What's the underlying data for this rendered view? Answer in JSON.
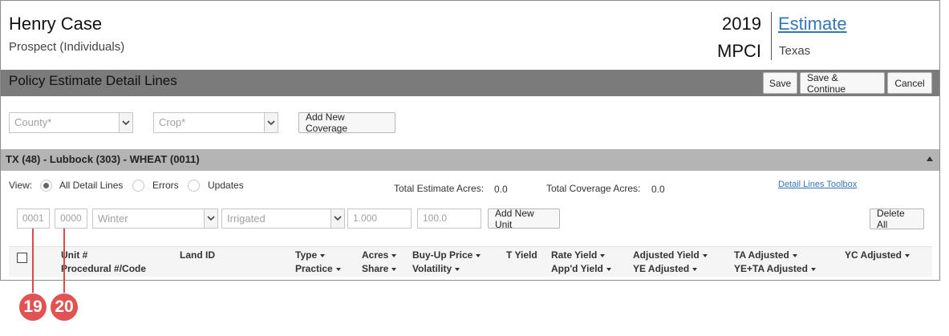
{
  "header": {
    "client_name": "Henry Case",
    "client_type": "Prospect (Individuals)",
    "year": "2019",
    "plan": "MPCI",
    "estimate_link": "Estimate",
    "state": "Texas"
  },
  "title_bar": {
    "title": "Policy Estimate Detail Lines",
    "save_label": "Save",
    "save_continue_label": "Save & Continue",
    "cancel_label": "Cancel"
  },
  "coverage_filters": {
    "county_placeholder": "County*",
    "crop_placeholder": "Crop*",
    "add_coverage_label": "Add New Coverage"
  },
  "coverage": {
    "title": "TX (48) - Lubbock (303) - WHEAT (0011)",
    "view_label": "View:",
    "view_options": [
      "All Detail Lines",
      "Errors",
      "Updates"
    ],
    "view_selected": "All Detail Lines",
    "total_estimate_acres_label": "Total Estimate Acres:",
    "total_estimate_acres_value": "0.0",
    "total_coverage_acres_label": "Total Coverage Acres:",
    "total_coverage_acres_value": "0.0",
    "toolbox_link": "Detail Lines Toolbox"
  },
  "unit_entry": {
    "unit_placeholder": "0001",
    "sub_placeholder": "0000",
    "type_selected": "Winter",
    "practice_selected": "Irrigated",
    "acres_placeholder": "1.000",
    "share_placeholder": "100.0",
    "add_unit_label": "Add New Unit",
    "delete_all_label": "Delete All"
  },
  "table_headers": {
    "unit": "Unit #",
    "procedural": "Procedural #/Code",
    "land_id": "Land ID",
    "type": "Type",
    "practice": "Practice",
    "acres": "Acres",
    "share": "Share",
    "buyup": "Buy-Up Price",
    "volatility": "Volatility",
    "t_yield": "T Yield",
    "rate_yield": "Rate Yield",
    "appd_yield": "App'd Yield",
    "adjusted_yield": "Adjusted Yield",
    "ye_adjusted": "YE Adjusted",
    "ta_adjusted": "TA Adjusted",
    "ye_ta_adjusted": "YE+TA Adjusted",
    "yc_adjusted": "YC Adjusted"
  },
  "callouts": {
    "first": "19",
    "second": "20",
    "color": "#e05353"
  },
  "colors": {
    "title_bar": "#7b7b7b",
    "coverage_bar": "#b4b4b4",
    "link": "#3377b8"
  }
}
